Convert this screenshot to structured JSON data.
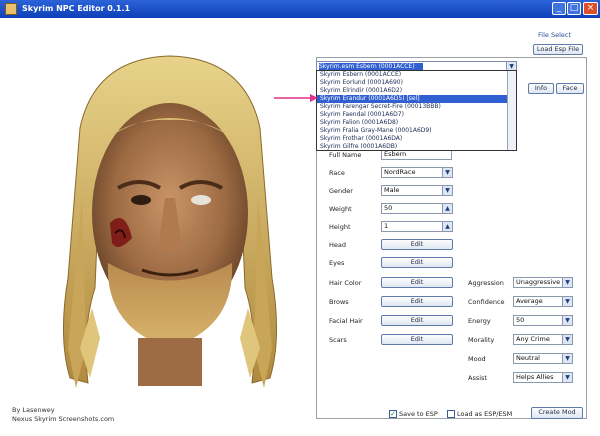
{
  "window": {
    "title": "Skyrim NPC Editor 0.1.1",
    "minimize_glyph": "_",
    "maximize_glyph": "□",
    "close_glyph": "×"
  },
  "preview": {
    "credit_line1": "By Lasenwey",
    "credit_line2": "Nexus Skyrim Screenshots.com"
  },
  "header": {
    "link_text": "File Select",
    "combo_value": "Skyrim.esm  Esbern (0001ACCE)",
    "load_button": "Load Esp File"
  },
  "dropdown": {
    "items": [
      "Skyrim Esbern (0001ACCE)",
      "Skyrim Eorlund (0001A690)",
      "Skyrim Elrindir (0001A6D2)",
      "Skyrim Erandur (0001A6D5) [sel]",
      "Skyrim Farengar Secret-Fire (00013BBB)",
      "Skyrim Faendal (0001A6D7)",
      "Skyrim Falion (0001A6D8)",
      "Skyrim Fralia Gray-Mane (0001A6D9)",
      "Skyrim Frothar (0001A6DA)",
      "Skyrim Gilfre (0001A6DB)"
    ],
    "selected_index": 3
  },
  "tab_buttons": [
    "Info",
    "Face"
  ],
  "fields": {
    "name_label": "Full Name",
    "name_value": "Esbern",
    "race_label": "Race",
    "race_value": "NordRace",
    "gender_label": "Gender",
    "gender_value": "Male",
    "weight_label": "Weight",
    "weight_value": "50",
    "height_label": "Height",
    "height_value": "1",
    "face_label": "Head",
    "face_button": "Edit",
    "eyes_label": "Eyes",
    "eyes_button": "Edit",
    "hair_label": "Hair Color",
    "hair_button": "Edit",
    "brow_label": "Brows",
    "brow_button": "Edit",
    "beard_label": "Facial Hair",
    "beard_button": "Edit",
    "scars_label": "Scars",
    "scars_button": "Edit"
  },
  "right_fields": {
    "r1_label": "Aggression",
    "r1_value": "Unaggressive",
    "r2_label": "Confidence",
    "r2_value": "Average",
    "r3_label": "Energy",
    "r3_value": "50",
    "r4_label": "Morality",
    "r4_value": "Any Crime",
    "r5_label": "Mood",
    "r5_value": "Neutral",
    "r6_label": "Assist",
    "r6_value": "Helps Allies"
  },
  "footer": {
    "check1_label": "Save to ESP",
    "check2_label": "Load as ESP/ESM",
    "save_button": "Create Mod"
  },
  "colors": {
    "accent": "#2f5fd0",
    "pointer": "#e0308a"
  }
}
